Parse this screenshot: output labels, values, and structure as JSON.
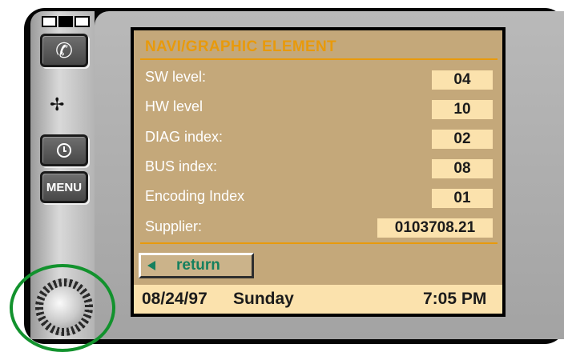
{
  "screen": {
    "title": "NAVI/GRAPHIC ELEMENT"
  },
  "fields": [
    {
      "label": "SW level:",
      "value": "04"
    },
    {
      "label": "HW level",
      "value": "10"
    },
    {
      "label": "DIAG index:",
      "value": "02"
    },
    {
      "label": "BUS index:",
      "value": "08"
    },
    {
      "label": "Encoding Index",
      "value": "01"
    },
    {
      "label": "Supplier:",
      "value": "0103708.21"
    }
  ],
  "return_button": {
    "label": "return"
  },
  "status": {
    "date": "08/24/97",
    "day": "Sunday",
    "time": "7:05 PM"
  },
  "hardware": {
    "menu_label": "MENU",
    "phone_icon": "phone-icon",
    "fan_icon": "fan-icon",
    "clock_icon": "clock-icon"
  },
  "colors": {
    "lcd_background": "#c4a87a",
    "title_accent": "#e89a0c",
    "value_box": "#fbe2ad",
    "return_text": "#15805e",
    "knob_highlight": "#12922d"
  }
}
